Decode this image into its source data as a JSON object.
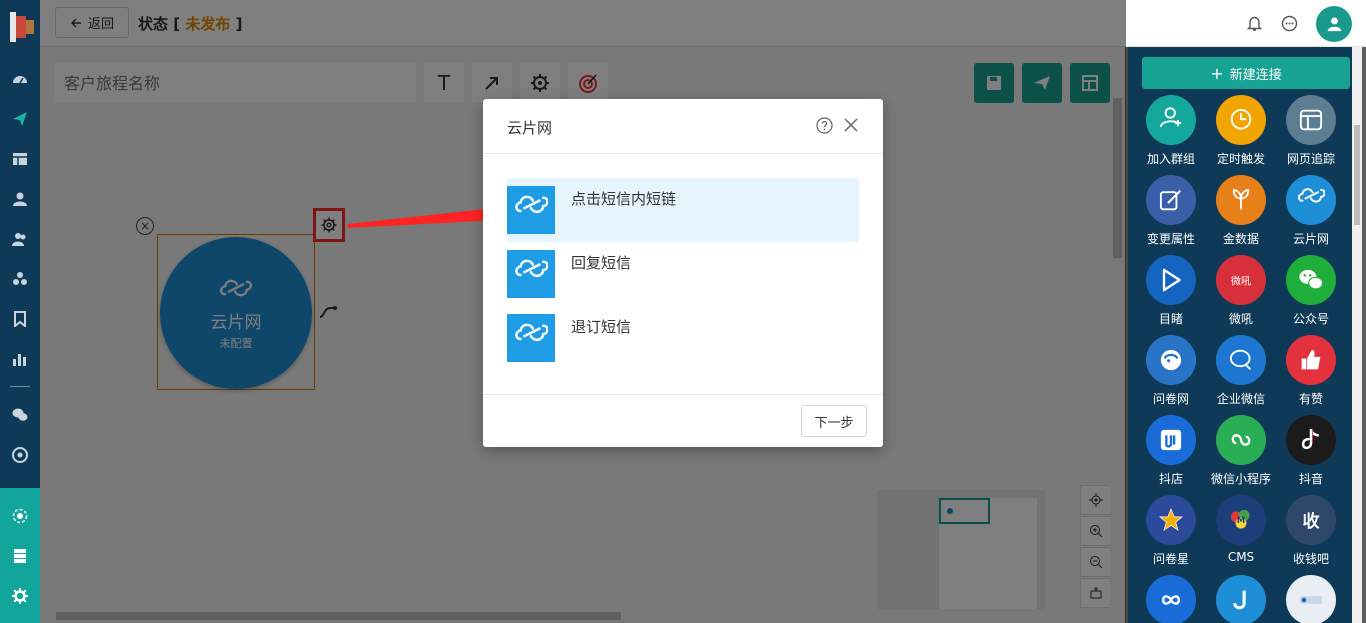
{
  "header": {
    "back_label": "返回",
    "title_prefix": "状态",
    "bracket_open": "[",
    "bracket_close": "]",
    "status": "未发布"
  },
  "toolbar": {
    "name_placeholder": "客户旅程名称",
    "text_tool_glyph": "T"
  },
  "node": {
    "name": "云片网",
    "status": "未配置"
  },
  "dialog": {
    "title": "云片网",
    "options": [
      {
        "label": "点击短信内短链",
        "selected": true
      },
      {
        "label": "回复短信",
        "selected": false
      },
      {
        "label": "退订短信",
        "selected": false
      }
    ],
    "next_label": "下一步"
  },
  "right_panel": {
    "new_connection": "新建连接",
    "components": [
      {
        "label": "加入群组",
        "color": "#14a89c",
        "icon": "user-plus-icon"
      },
      {
        "label": "定时触发",
        "color": "#f2a400",
        "icon": "clock-icon"
      },
      {
        "label": "网页追踪",
        "color": "#5d7d93",
        "icon": "webpage-icon"
      },
      {
        "label": "变更属性",
        "color": "#3a5fa8",
        "icon": "edit-icon"
      },
      {
        "label": "金数据",
        "color": "#e8801a",
        "icon": "jinshuju-icon"
      },
      {
        "label": "云片网",
        "color": "#1e8fd6",
        "icon": "cloud-icon"
      },
      {
        "label": "目睹",
        "color": "#1565c0",
        "icon": "play-icon"
      },
      {
        "label": "微吼",
        "color": "#d8303a",
        "icon": "weihou-icon"
      },
      {
        "label": "公众号",
        "color": "#1fae3b",
        "icon": "wechat-icon"
      },
      {
        "label": "问卷网",
        "color": "#2a74c7",
        "icon": "wenjuan-icon"
      },
      {
        "label": "企业微信",
        "color": "#1d77d1",
        "icon": "wecom-icon"
      },
      {
        "label": "有赞",
        "color": "#e4313e",
        "icon": "thumb-up-icon"
      },
      {
        "label": "抖店",
        "color": "#1a6cd8",
        "icon": "doudian-icon"
      },
      {
        "label": "微信小程序",
        "color": "#2aae53",
        "icon": "miniprogram-icon"
      },
      {
        "label": "抖音",
        "color": "#1b1b1b",
        "icon": "tiktok-icon"
      },
      {
        "label": "问卷星",
        "color": "#2c4a9c",
        "icon": "star-icon"
      },
      {
        "label": "CMS",
        "color": "#1c3f7a",
        "icon": "cms-icon"
      },
      {
        "label": "收钱吧",
        "color": "#2e4668",
        "icon": "shouqianba-icon"
      }
    ],
    "partial": [
      {
        "color": "#1a6cd8",
        "icon": "infinity-icon"
      },
      {
        "color": "#1e8fd6",
        "icon": "hook-icon"
      },
      {
        "color": "#e9eef4",
        "icon": "zhiyi-icon"
      }
    ]
  }
}
